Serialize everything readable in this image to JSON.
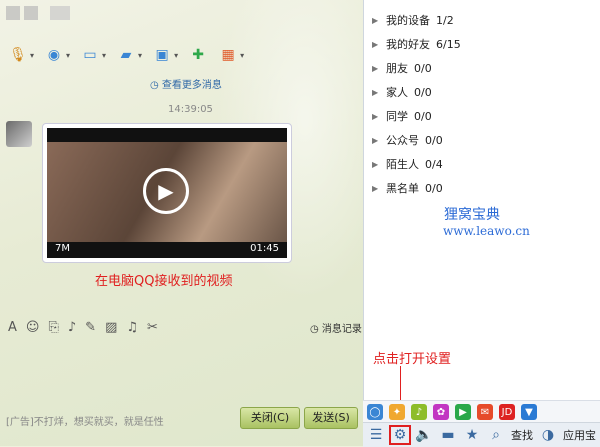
{
  "chat": {
    "toolbar_icons": [
      "microphone-icon",
      "camera-icon",
      "screen-share-icon",
      "file-transfer-icon",
      "remote-desktop-icon",
      "message-add-icon",
      "apps-icon"
    ],
    "more_messages": "查看更多消息",
    "timestamp": "14:39:05",
    "video": {
      "size": "7M",
      "duration": "01:45"
    },
    "caption": "在电脑QQ接收到的视频",
    "input_icons": [
      "font-icon",
      "emoji-icon",
      "screenshot-icon",
      "voice-icon",
      "edit-icon",
      "image-icon",
      "music-icon",
      "scissors-icon"
    ],
    "message_record": "消息记录",
    "ad": "[广告]不打烊，想买就买，就是任性",
    "close_button": "关闭(C)",
    "send_button": "发送(S)"
  },
  "contacts": {
    "groups": [
      {
        "label": "我的设备",
        "count": "1/2"
      },
      {
        "label": "我的好友",
        "count": "6/15"
      },
      {
        "label": "朋友",
        "count": "0/0"
      },
      {
        "label": "家人",
        "count": "0/0"
      },
      {
        "label": "同学",
        "count": "0/0"
      },
      {
        "label": "公众号",
        "count": "0/0"
      },
      {
        "label": "陌生人",
        "count": "0/4"
      },
      {
        "label": "黑名单",
        "count": "0/0"
      }
    ]
  },
  "watermark": {
    "name": "狸窝宝典",
    "url": "www.leawo.cn"
  },
  "annotation": {
    "text": "点击打开设置"
  },
  "bottom_bar": {
    "search": "查找",
    "app_store": "应用宝"
  },
  "colors": {
    "annotation_red": "#e02020",
    "watermark_blue": "#2c6bd6",
    "button_green": "#a9c262"
  }
}
